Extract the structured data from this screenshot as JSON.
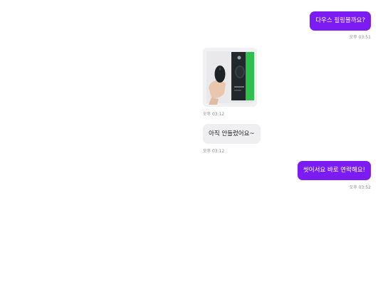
{
  "messages": [
    {
      "id": "msg1",
      "direction": "outgoing",
      "text": "다우스 필링몰까요?",
      "time": "오후 03:51"
    },
    {
      "id": "msg2",
      "direction": "incoming",
      "type": "image",
      "image_subject": "mouse-product-photo",
      "time": "오후 03:12"
    },
    {
      "id": "msg3",
      "direction": "incoming",
      "text": "아직 안들렸어요~",
      "time": "오후 03:12"
    },
    {
      "id": "msg4",
      "direction": "outgoing",
      "text": "씻어서요 바로 연락해요!",
      "time": "오후 03:52"
    }
  ],
  "colors": {
    "outgoing_bubble": "#7b1df2",
    "incoming_bubble": "#efeff1",
    "timestamp": "#8a8a8a",
    "box_green": "#2fbf4f"
  }
}
